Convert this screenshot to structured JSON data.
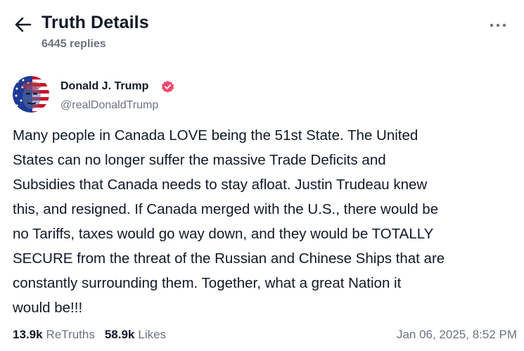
{
  "header": {
    "title": "Truth Details",
    "replies": "6445 replies"
  },
  "icons": {
    "back": "arrow-left-icon",
    "more": "more-horizontal-icon",
    "verified": "verified-badge-icon"
  },
  "author": {
    "name": "Donald J. Trump",
    "handle": "@realDonaldTrump"
  },
  "post": {
    "text": "Many people in Canada LOVE being the 51st State. The United\nStates can no longer suffer the massive Trade Deficits and\nSubsidies that Canada needs to stay afloat. Justin Trudeau knew\nthis, and resigned. If Canada merged with the U.S., there would be\nno Tariffs, taxes would go way down, and they would be TOTALLY\nSECURE from the threat of the Russian and Chinese Ships that are\nconstantly surrounding them. Together, what a great Nation it\nwould be!!!"
  },
  "stats": {
    "retruths_count": "13.9k",
    "retruths_label": "ReTruths",
    "likes_count": "58.9k",
    "likes_label": "Likes",
    "timestamp": "Jan 06, 2025, 8:52 PM"
  },
  "colors": {
    "text": "#111827",
    "muted": "#6b7280",
    "verified": "#f0476d"
  }
}
